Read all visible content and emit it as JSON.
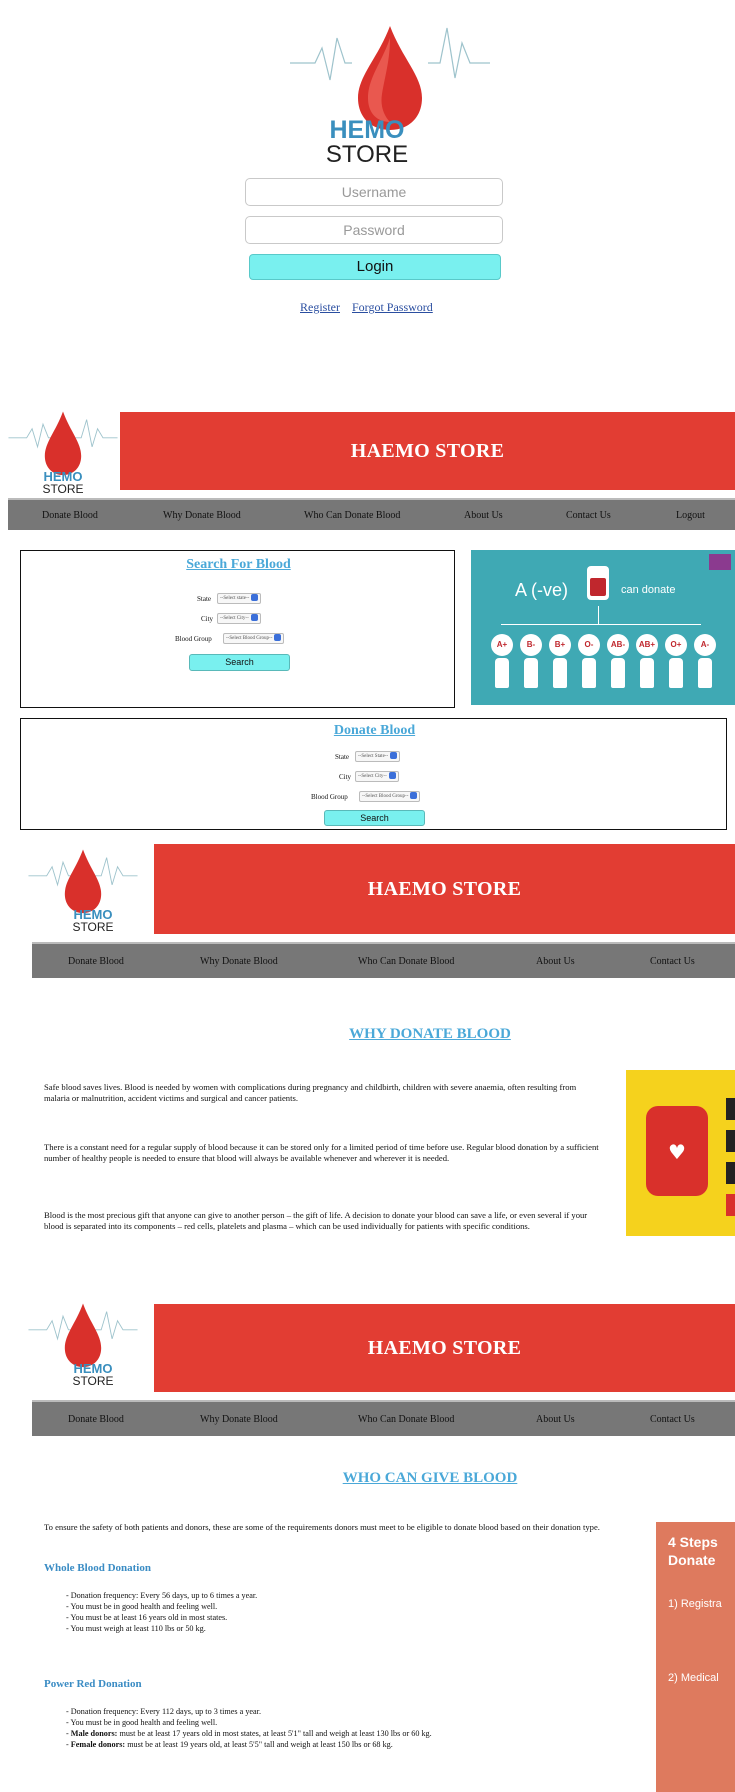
{
  "login": {
    "brand_top": "HEMO",
    "brand_bottom": "STORE",
    "username_placeholder": "Username",
    "password_placeholder": "Password",
    "login_label": "Login",
    "register_link": "Register",
    "forgot_link": "Forgot Password"
  },
  "header": {
    "brand_top": "HEMO",
    "brand_bottom": "STORE",
    "title": "HAEMO STORE",
    "nav": [
      "Donate Blood",
      "Why Donate Blood",
      "Who Can Donate Blood",
      "About Us",
      "Contact Us",
      "Logout"
    ]
  },
  "search_panel": {
    "title": "Search For Blood",
    "state_label": "State",
    "state_select": "--Select state--",
    "city_label": "City",
    "city_select": "--Select City--",
    "group_label": "Blood Group",
    "group_select": "--Select Blood Group--",
    "button": "Search"
  },
  "donor_image": {
    "headline": "A (-ve)",
    "text": "can donate",
    "groups": [
      "A+",
      "B-",
      "B+",
      "O-",
      "AB-",
      "AB+",
      "O+",
      "A-"
    ]
  },
  "donate_panel": {
    "title": "Donate Blood",
    "state_label": "State",
    "state_select": "--Select State--",
    "city_label": "City",
    "city_select": "--Select City--",
    "group_label": "Blood Group",
    "group_select": "--Select Blood Group--",
    "button": "Search"
  },
  "why": {
    "title": "WHY DONATE BLOOD",
    "paragraphs": [
      "Safe blood saves lives. Blood is needed by women with complications during pregnancy and childbirth, children with severe anaemia, often resulting from malaria or malnutrition, accident victims and surgical and cancer patients.",
      "There is a constant need for a regular supply of blood because it can be stored only for a limited period of time before use. Regular blood donation by a sufficient number of healthy people is needed to ensure that blood will always be available whenever and wherever it is needed.",
      "Blood is the most precious gift that anyone can give to another person – the gift of life. A decision to donate your blood can save a life, or even several if your blood is separated into its components – red cells, platelets and plasma – which can be used individually for patients with specific conditions."
    ]
  },
  "who": {
    "title": "WHO CAN GIVE BLOOD",
    "intro": "To ensure the safety of both patients and donors, these are some of the requirements donors must meet to be eligible to donate blood based on their donation type.",
    "whole_title": "Whole Blood Donation",
    "whole_items": [
      "- Donation frequency: Every 56 days, up to 6 times a year.",
      "- You must be in good health and feeling well.",
      "- You must be at least 16 years old in most states.",
      "- You must weigh at least 110 lbs or 50 kg."
    ],
    "power_title": "Power Red Donation",
    "power_items": [
      "- Donation frequency: Every 112 days, up to 3 times a year.",
      "- You must be in good health and feeling well."
    ],
    "male_label": "Male donors:",
    "male_text": " must be at least 17 years old in most states, at least 5'1\" tall and weigh at least 130 lbs or 60 kg.",
    "female_label": "Female donors:",
    "female_text": " must be at least 19 years old, at least 5'5\" tall and weigh at least 150 lbs or 68 kg.",
    "steps_title_1": "4 Steps",
    "steps_title_2": "Donate",
    "step_1": "1) Registra",
    "step_2": "2) Medical"
  },
  "colors": {
    "brand_red": "#e23d33",
    "cyan_button": "#79f0ef",
    "link_blue": "#4aa8d8",
    "nav_gray": "#777777",
    "steps_orange": "#de7a5e",
    "image_teal": "#3fa9b4"
  }
}
